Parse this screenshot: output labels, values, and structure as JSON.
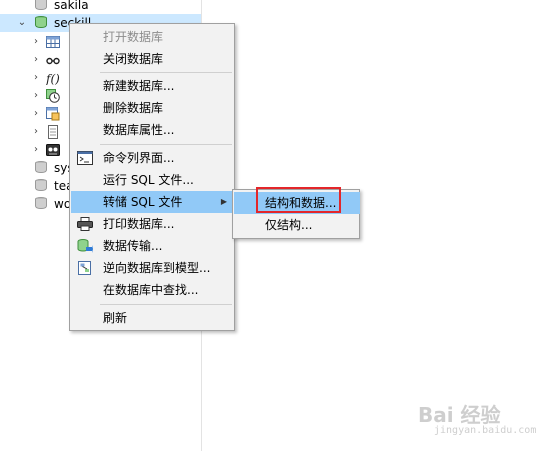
{
  "tree": {
    "rows": [
      {
        "label": "sakila"
      },
      {
        "label": "seckill",
        "expander": "⌄"
      },
      {
        "label": "sys"
      },
      {
        "label": "tea"
      },
      {
        "label": "wo"
      }
    ],
    "child_expander": "›"
  },
  "context_menu": {
    "items": [
      {
        "label": "打开数据库"
      },
      {
        "label": "关闭数据库"
      },
      {
        "label": "新建数据库..."
      },
      {
        "label": "删除数据库"
      },
      {
        "label": "数据库属性..."
      },
      {
        "label": "命令列界面..."
      },
      {
        "label": "运行 SQL 文件..."
      },
      {
        "label": "转储 SQL 文件",
        "arrow": "▶"
      },
      {
        "label": "打印数据库..."
      },
      {
        "label": "数据传输..."
      },
      {
        "label": "逆向数据库到模型..."
      },
      {
        "label": "在数据库中查找..."
      },
      {
        "label": "刷新"
      }
    ]
  },
  "submenu": {
    "items": [
      {
        "label": "结构和数据..."
      },
      {
        "label": "仅结构..."
      }
    ]
  },
  "watermark": {
    "main": "Bai 经验",
    "sub": "jingyan.baidu.com"
  },
  "colors": {
    "selection": "#cce8ff",
    "menu_active": "#91c9f7",
    "highlight": "#e3262a"
  }
}
